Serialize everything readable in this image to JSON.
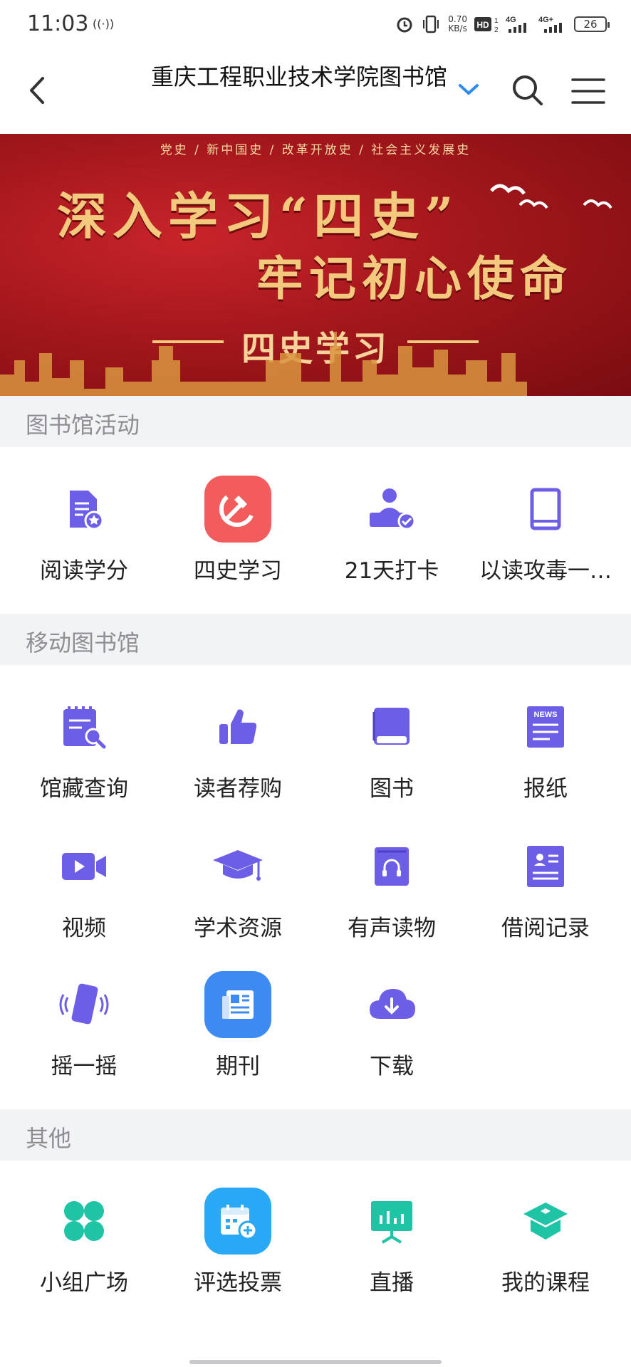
{
  "status_bar": {
    "time": "11:03",
    "speed_value": "0.70",
    "speed_unit": "KB/s",
    "battery": "26"
  },
  "header": {
    "title": "重庆工程职业技术学院图书馆"
  },
  "banner": {
    "subtitle": "党史 / 新中国史 / 改革开放史 / 社会主义发展史",
    "line1": "深入学习“四史”",
    "line2": "牢记初心使命",
    "line3": "四史学习"
  },
  "sections": {
    "activities": {
      "title": "图书馆活动",
      "items": [
        {
          "label": "阅读学分",
          "icon": "reading-credit-icon"
        },
        {
          "label": "四史学习",
          "icon": "hammer-sickle-icon"
        },
        {
          "label": "21天打卡",
          "icon": "check-in-icon"
        },
        {
          "label": "以读攻毒一…",
          "icon": "book-icon"
        }
      ]
    },
    "mobile_library": {
      "title": "移动图书馆",
      "items": [
        {
          "label": "馆藏查询",
          "icon": "catalog-search-icon"
        },
        {
          "label": "读者荐购",
          "icon": "thumbs-up-icon"
        },
        {
          "label": "图书",
          "icon": "book-icon"
        },
        {
          "label": "报纸",
          "icon": "newspaper-icon",
          "badge": "NEWS"
        },
        {
          "label": "视频",
          "icon": "video-icon"
        },
        {
          "label": "学术资源",
          "icon": "graduation-cap-icon"
        },
        {
          "label": "有声读物",
          "icon": "audiobook-icon"
        },
        {
          "label": "借阅记录",
          "icon": "borrow-record-icon"
        },
        {
          "label": "摇一摇",
          "icon": "shake-phone-icon"
        },
        {
          "label": "期刊",
          "icon": "journal-icon"
        },
        {
          "label": "下载",
          "icon": "cloud-download-icon"
        }
      ]
    },
    "other": {
      "title": "其他",
      "items": [
        {
          "label": "小组广场",
          "icon": "group-square-icon"
        },
        {
          "label": "评选投票",
          "icon": "vote-calendar-icon"
        },
        {
          "label": "直播",
          "icon": "live-broadcast-icon"
        },
        {
          "label": "我的课程",
          "icon": "my-course-icon"
        }
      ]
    }
  },
  "colors": {
    "icon_purple": "#6d5ee8",
    "tile_red": "#f25c5c",
    "tile_blue": "#3d8bf2",
    "tile_sky": "#29a8f5",
    "icon_teal": "#1fc3a6",
    "accent_blue": "#2d8cf0",
    "section_bg": "#f2f3f7"
  }
}
